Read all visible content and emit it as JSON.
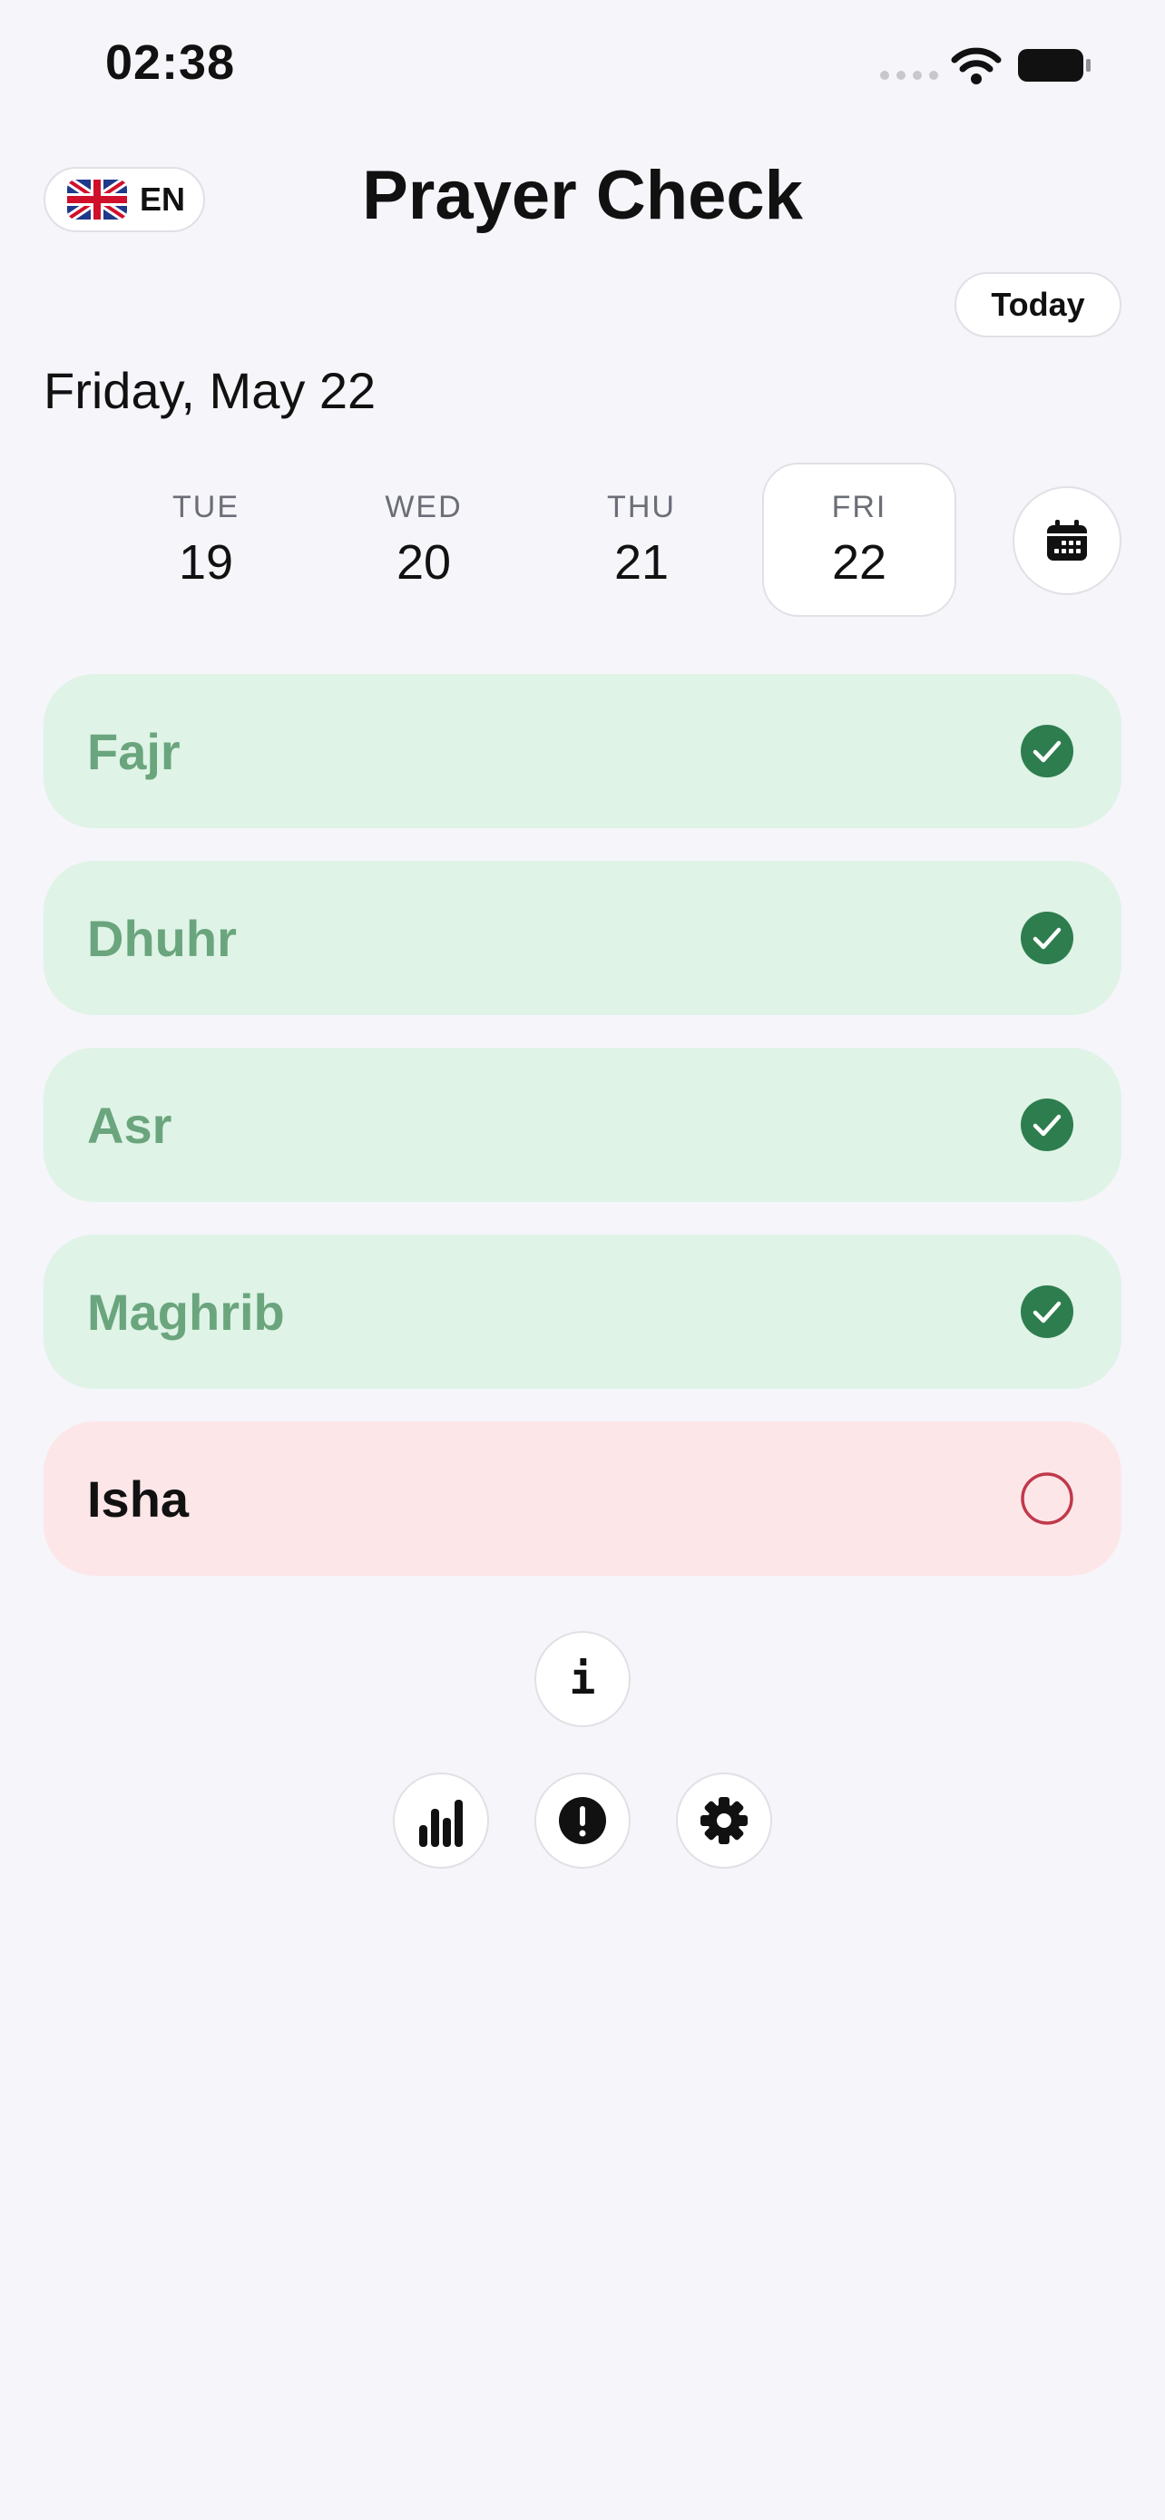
{
  "status_bar": {
    "time": "02:38"
  },
  "header": {
    "language_code": "EN",
    "title": "Prayer Check",
    "today_label": "Today"
  },
  "date_heading": "Friday, May 22",
  "days": [
    {
      "name": "TUE",
      "num": "19",
      "selected": false
    },
    {
      "name": "WED",
      "num": "20",
      "selected": false
    },
    {
      "name": "THU",
      "num": "21",
      "selected": false
    },
    {
      "name": "FRI",
      "num": "22",
      "selected": true
    }
  ],
  "prayers": [
    {
      "name": "Fajr",
      "done": true
    },
    {
      "name": "Dhuhr",
      "done": true
    },
    {
      "name": "Asr",
      "done": true
    },
    {
      "name": "Maghrib",
      "done": true
    },
    {
      "name": "Isha",
      "done": false
    }
  ],
  "bottom": {
    "info_label": "i",
    "icons": [
      "bar-chart-icon",
      "exclamation-icon",
      "gear-icon"
    ]
  },
  "colors": {
    "background": "#f5f5fa",
    "done_card": "#dff3e6",
    "done_text": "#6aa57d",
    "check_fill": "#2e7d4f",
    "pending_card": "#fde6e8",
    "pending_ring": "#c0394a"
  }
}
